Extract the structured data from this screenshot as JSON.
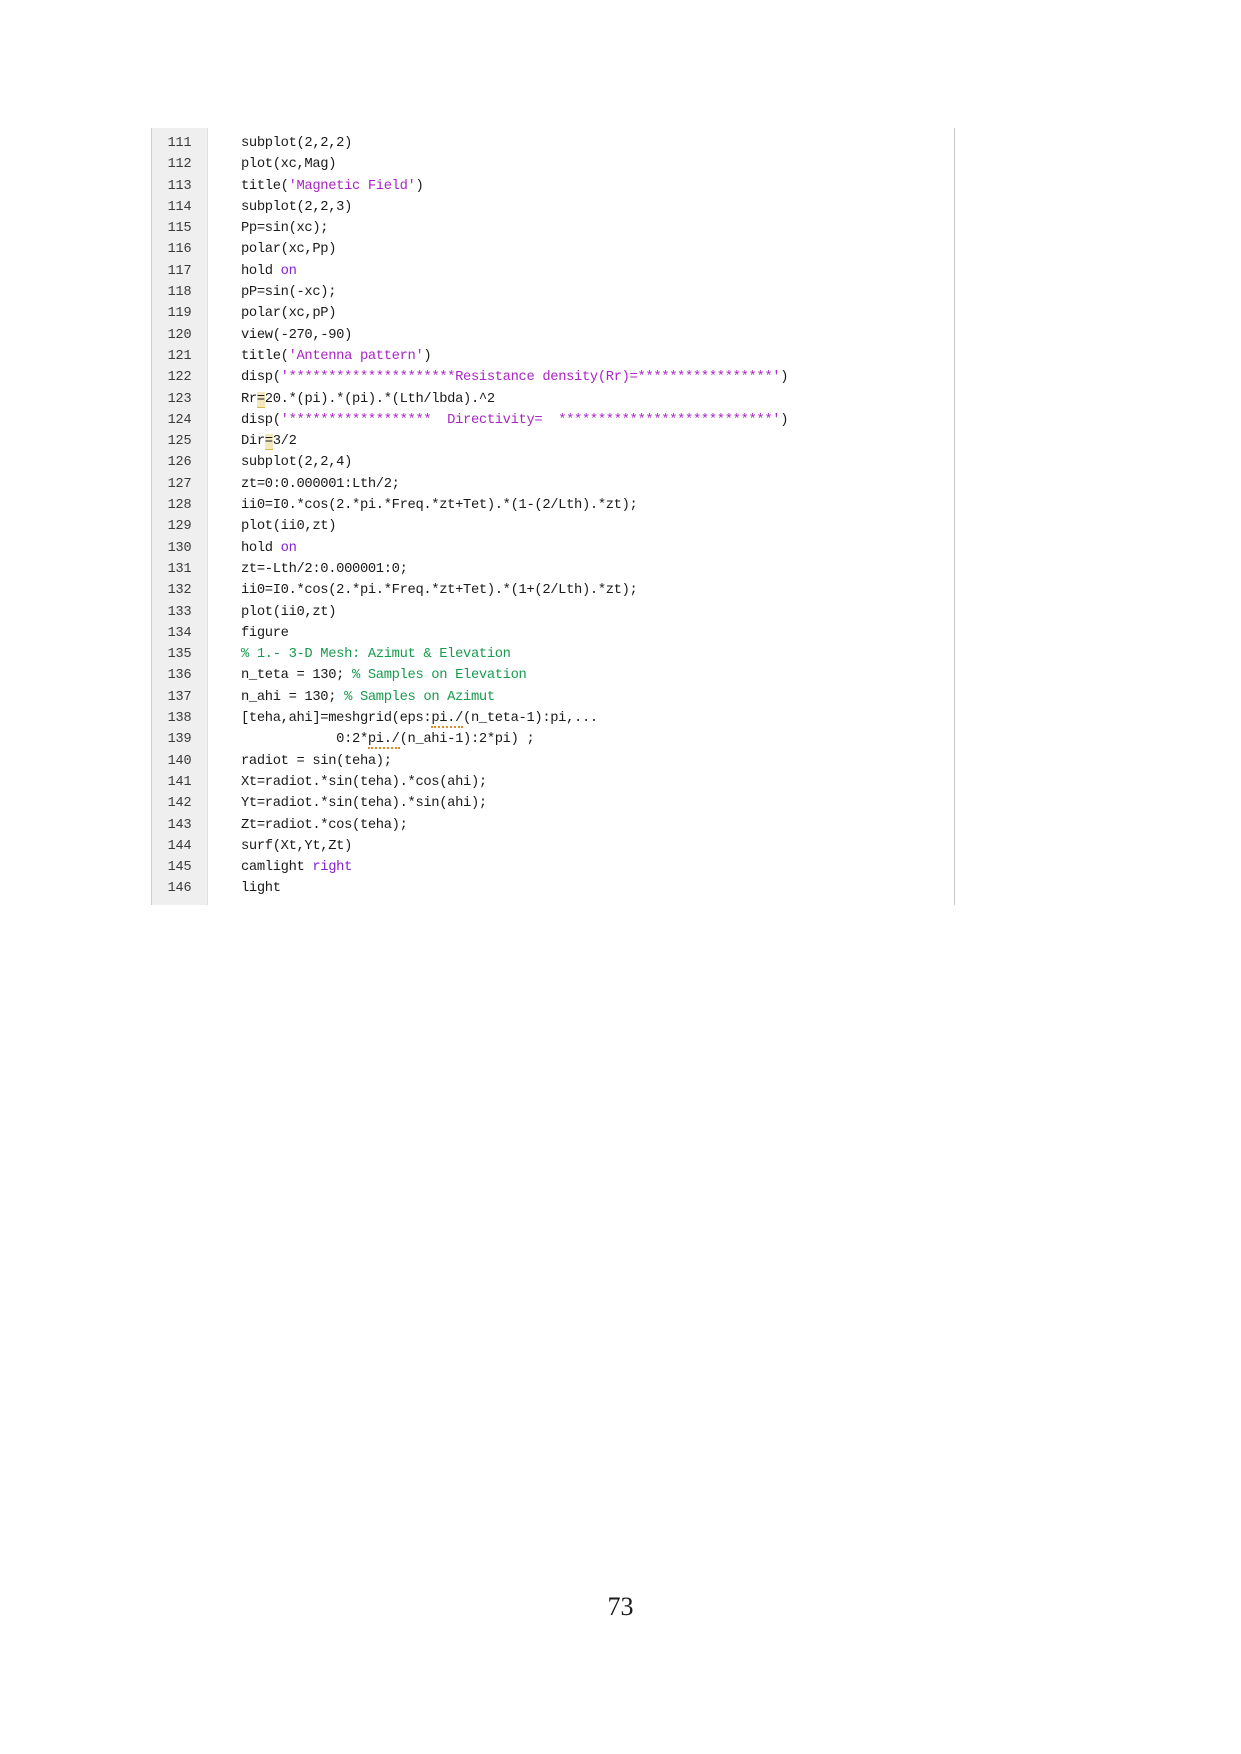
{
  "document": {
    "page_number": "73",
    "listing_language": "matlab",
    "colors": {
      "string": "#a926c4",
      "keyword": "#8321d6",
      "comment": "#179a4d",
      "plain": "#1a1a1a",
      "gutter_background": "#f0eff0",
      "highlight": "#f2e7bd",
      "page_background": "#ffffff"
    }
  },
  "code": {
    "first_line_number": 111,
    "last_line_number": 146,
    "line_numbers": [
      "111",
      "112",
      "113",
      "114",
      "115",
      "116",
      "117",
      "118",
      "119",
      "120",
      "121",
      "122",
      "123",
      "124",
      "125",
      "126",
      "127",
      "128",
      "129",
      "130",
      "131",
      "132",
      "133",
      "134",
      "135",
      "136",
      "137",
      "138",
      "139",
      "140",
      "141",
      "142",
      "143",
      "144",
      "145",
      "146"
    ],
    "lines": [
      {
        "number": "111",
        "text": "subplot(2,2,2)"
      },
      {
        "number": "112",
        "text": "plot(xc,Mag)"
      },
      {
        "number": "113",
        "text": "title('Magnetic Field')"
      },
      {
        "number": "114",
        "text": "subplot(2,2,3)"
      },
      {
        "number": "115",
        "text": "Pp=sin(xc);"
      },
      {
        "number": "116",
        "text": "polar(xc,Pp)"
      },
      {
        "number": "117",
        "text": "hold on"
      },
      {
        "number": "118",
        "text": "pP=sin(-xc);"
      },
      {
        "number": "119",
        "text": "polar(xc,pP)"
      },
      {
        "number": "120",
        "text": "view(-270,-90)"
      },
      {
        "number": "121",
        "text": "title('Antenna pattern')"
      },
      {
        "number": "122",
        "text": "disp('*********************Resistance density(Rr)=*****************')"
      },
      {
        "number": "123",
        "text": "Rr=20.*(pi).*(pi).*(Lth/lbda).^2"
      },
      {
        "number": "124",
        "text": "disp('******************  Directivity=  ***************************')"
      },
      {
        "number": "125",
        "text": "Dir=3/2"
      },
      {
        "number": "126",
        "text": "subplot(2,2,4)"
      },
      {
        "number": "127",
        "text": "zt=0:0.000001:Lth/2;"
      },
      {
        "number": "128",
        "text": "ii0=I0.*cos(2.*pi.*Freq.*zt+Tet).*(1-(2/Lth).*zt);"
      },
      {
        "number": "129",
        "text": "plot(ii0,zt)"
      },
      {
        "number": "130",
        "text": "hold on"
      },
      {
        "number": "131",
        "text": "zt=-Lth/2:0.000001:0;"
      },
      {
        "number": "132",
        "text": "ii0=I0.*cos(2.*pi.*Freq.*zt+Tet).*(1+(2/Lth).*zt);"
      },
      {
        "number": "133",
        "text": "plot(ii0,zt)"
      },
      {
        "number": "134",
        "text": "figure"
      },
      {
        "number": "135",
        "text": "% 1.- 3-D Mesh: Azimut & Elevation"
      },
      {
        "number": "136",
        "text": "n_teta = 130; % Samples on Elevation"
      },
      {
        "number": "137",
        "text": "n_ahi = 130; % Samples on Azimut"
      },
      {
        "number": "138",
        "text": "[teha,ahi]=meshgrid(eps:pi./(n_teta-1):pi,..."
      },
      {
        "number": "139",
        "text": "            0:2*pi./(n_ahi-1):2*pi) ;"
      },
      {
        "number": "140",
        "text": "radiot = sin(teha);"
      },
      {
        "number": "141",
        "text": "Xt=radiot.*sin(teha).*cos(ahi);"
      },
      {
        "number": "142",
        "text": "Yt=radiot.*sin(teha).*sin(ahi);"
      },
      {
        "number": "143",
        "text": "Zt=radiot.*cos(teha);"
      },
      {
        "number": "144",
        "text": "surf(Xt,Yt,Zt)"
      },
      {
        "number": "145",
        "text": "camlight right"
      },
      {
        "number": "146",
        "text": "light"
      }
    ],
    "segments": [
      {
        "n": "111",
        "parts": [
          {
            "t": "subplot(2,2,2)",
            "c": "plain"
          }
        ]
      },
      {
        "n": "112",
        "parts": [
          {
            "t": "plot(xc,Mag)",
            "c": "plain"
          }
        ]
      },
      {
        "n": "113",
        "parts": [
          {
            "t": "title(",
            "c": "plain"
          },
          {
            "t": "'Magnetic Field'",
            "c": "str"
          },
          {
            "t": ")",
            "c": "plain"
          }
        ]
      },
      {
        "n": "114",
        "parts": [
          {
            "t": "subplot(2,2,3)",
            "c": "plain"
          }
        ]
      },
      {
        "n": "115",
        "parts": [
          {
            "t": "Pp=sin(xc);",
            "c": "plain"
          }
        ]
      },
      {
        "n": "116",
        "parts": [
          {
            "t": "polar(xc,Pp)",
            "c": "plain"
          }
        ]
      },
      {
        "n": "117",
        "parts": [
          {
            "t": "hold ",
            "c": "plain"
          },
          {
            "t": "on",
            "c": "kw"
          }
        ]
      },
      {
        "n": "118",
        "parts": [
          {
            "t": "pP=sin(-xc);",
            "c": "plain"
          }
        ]
      },
      {
        "n": "119",
        "parts": [
          {
            "t": "polar(xc,pP)",
            "c": "plain"
          }
        ]
      },
      {
        "n": "120",
        "parts": [
          {
            "t": "view(-270,-90)",
            "c": "plain"
          }
        ]
      },
      {
        "n": "121",
        "parts": [
          {
            "t": "title(",
            "c": "plain"
          },
          {
            "t": "'Antenna pattern'",
            "c": "str"
          },
          {
            "t": ")",
            "c": "plain"
          }
        ]
      },
      {
        "n": "122",
        "parts": [
          {
            "t": "disp(",
            "c": "plain"
          },
          {
            "t": "'*********************Resistance density(Rr)=*****************'",
            "c": "str"
          },
          {
            "t": ")",
            "c": "plain"
          }
        ]
      },
      {
        "n": "123",
        "parts": [
          {
            "t": "Rr",
            "c": "plain"
          },
          {
            "t": "=",
            "c": "hl"
          },
          {
            "t": "20.*(pi).*(pi).*(Lth/lbda).^2",
            "c": "plain"
          }
        ]
      },
      {
        "n": "124",
        "parts": [
          {
            "t": "disp(",
            "c": "plain"
          },
          {
            "t": "'******************  Directivity=  ***************************'",
            "c": "str"
          },
          {
            "t": ")",
            "c": "plain"
          }
        ]
      },
      {
        "n": "125",
        "parts": [
          {
            "t": "Dir",
            "c": "plain"
          },
          {
            "t": "=",
            "c": "hl"
          },
          {
            "t": "3/2",
            "c": "plain"
          }
        ]
      },
      {
        "n": "126",
        "parts": [
          {
            "t": "subplot(2,2,4)",
            "c": "plain"
          }
        ]
      },
      {
        "n": "127",
        "parts": [
          {
            "t": "zt=0:0.000001:Lth/2;",
            "c": "plain"
          }
        ]
      },
      {
        "n": "128",
        "parts": [
          {
            "t": "ii0=I0.*cos(2.*pi.*Freq.*zt+Tet).*(1-(2/Lth).*zt);",
            "c": "plain"
          }
        ]
      },
      {
        "n": "129",
        "parts": [
          {
            "t": "plot(ii0,zt)",
            "c": "plain"
          }
        ]
      },
      {
        "n": "130",
        "parts": [
          {
            "t": "hold ",
            "c": "plain"
          },
          {
            "t": "on",
            "c": "kw"
          }
        ]
      },
      {
        "n": "131",
        "parts": [
          {
            "t": "zt=-Lth/2:0.000001:0;",
            "c": "plain"
          }
        ]
      },
      {
        "n": "132",
        "parts": [
          {
            "t": "ii0=I0.*cos(2.*pi.*Freq.*zt+Tet).*(1+(2/Lth).*zt);",
            "c": "plain"
          }
        ]
      },
      {
        "n": "133",
        "parts": [
          {
            "t": "plot(ii0,zt)",
            "c": "plain"
          }
        ]
      },
      {
        "n": "134",
        "parts": [
          {
            "t": "figure",
            "c": "plain"
          }
        ]
      },
      {
        "n": "135",
        "parts": [
          {
            "t": "% 1.- 3-D Mesh: Azimut & Elevation",
            "c": "com"
          }
        ]
      },
      {
        "n": "136",
        "parts": [
          {
            "t": "n_teta = 130; ",
            "c": "plain"
          },
          {
            "t": "% Samples on Elevation",
            "c": "com"
          }
        ]
      },
      {
        "n": "137",
        "parts": [
          {
            "t": "n_ahi = 130; ",
            "c": "plain"
          },
          {
            "t": "% Samples on Azimut",
            "c": "com"
          }
        ]
      },
      {
        "n": "138",
        "parts": [
          {
            "t": "[teha,ahi]=meshgrid(eps:",
            "c": "plain"
          },
          {
            "t": "pi./",
            "c": "wavy"
          },
          {
            "t": "(n_teta-1):pi,...",
            "c": "plain"
          }
        ]
      },
      {
        "n": "139",
        "parts": [
          {
            "t": "            0:2*",
            "c": "plain"
          },
          {
            "t": "pi./",
            "c": "wavy"
          },
          {
            "t": "(n_ahi-1):2*pi) ;",
            "c": "plain"
          }
        ]
      },
      {
        "n": "140",
        "parts": [
          {
            "t": "radiot = sin(teha);",
            "c": "plain"
          }
        ]
      },
      {
        "n": "141",
        "parts": [
          {
            "t": "Xt=radiot.*sin(teha).*cos(ahi);",
            "c": "plain"
          }
        ]
      },
      {
        "n": "142",
        "parts": [
          {
            "t": "Yt=radiot.*sin(teha).*sin(ahi);",
            "c": "plain"
          }
        ]
      },
      {
        "n": "143",
        "parts": [
          {
            "t": "Zt=radiot.*cos(teha);",
            "c": "plain"
          }
        ]
      },
      {
        "n": "144",
        "parts": [
          {
            "t": "surf(Xt,Yt,Zt)",
            "c": "plain"
          }
        ]
      },
      {
        "n": "145",
        "parts": [
          {
            "t": "camlight ",
            "c": "plain"
          },
          {
            "t": "right",
            "c": "kw"
          }
        ]
      },
      {
        "n": "146",
        "parts": [
          {
            "t": "light",
            "c": "plain"
          }
        ]
      }
    ]
  }
}
